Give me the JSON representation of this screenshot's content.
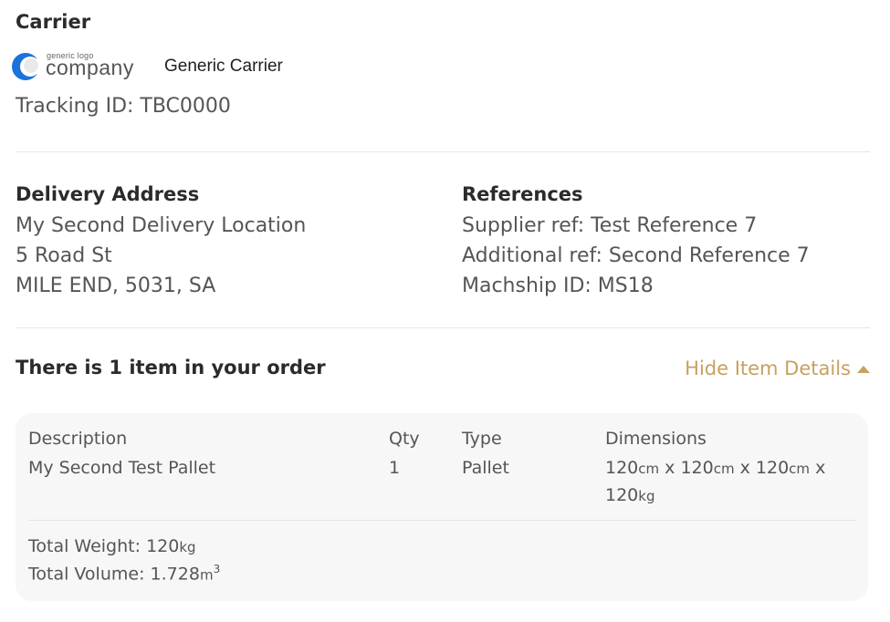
{
  "carrier": {
    "heading": "Carrier",
    "logo_small_text": "generic logo",
    "logo_big_text": "company",
    "name": "Generic Carrier",
    "tracking": "Tracking ID: TBC0000"
  },
  "delivery": {
    "heading": "Delivery Address",
    "lines": [
      "My Second Delivery Location",
      "5 Road St",
      "MILE END, 5031, SA"
    ]
  },
  "references": {
    "heading": "References",
    "lines": [
      "Supplier ref: Test Reference 7",
      "Additional ref: Second Reference 7",
      "Machship ID: MS18"
    ]
  },
  "order": {
    "title": "There is 1 item in your order",
    "toggle_label": "Hide Item Details",
    "columns": {
      "description": "Description",
      "qty": "Qty",
      "type": "Type",
      "dimensions": "Dimensions"
    },
    "items": [
      {
        "description": "My Second Test Pallet",
        "qty": "1",
        "type": "Pallet",
        "dim_l": "120",
        "dim_w": "120",
        "dim_h": "120",
        "dim_unit": "cm",
        "dim_sep": " x ",
        "weight": "120",
        "weight_unit": "kg"
      }
    ],
    "total_weight_label": "Total Weight: ",
    "total_weight_value": "120",
    "total_weight_unit": "kg",
    "total_volume_label": "Total Volume: ",
    "total_volume_value": "1.728",
    "total_volume_unit": "m",
    "total_volume_exp": "3"
  },
  "colors": {
    "accent": "#c9a060",
    "logo_blue": "#1a73d9",
    "box_bg": "#f7f7f7"
  }
}
